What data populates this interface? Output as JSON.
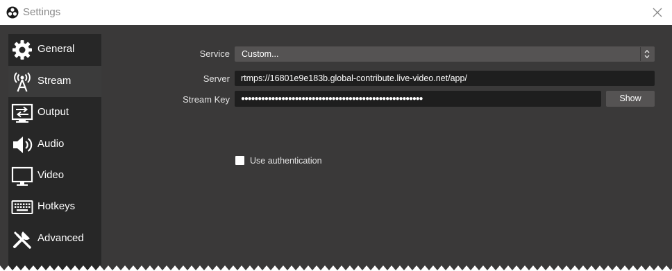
{
  "window": {
    "title": "Settings"
  },
  "sidebar": {
    "items": [
      {
        "label": "General",
        "icon": "gear-icon"
      },
      {
        "label": "Stream",
        "icon": "antenna-icon",
        "active": true
      },
      {
        "label": "Output",
        "icon": "output-icon"
      },
      {
        "label": "Audio",
        "icon": "speaker-icon"
      },
      {
        "label": "Video",
        "icon": "monitor-icon"
      },
      {
        "label": "Hotkeys",
        "icon": "keyboard-icon"
      },
      {
        "label": "Advanced",
        "icon": "tools-icon"
      }
    ]
  },
  "stream": {
    "service_label": "Service",
    "service_value": "Custom...",
    "server_label": "Server",
    "server_value": "rtmps://16801e9e183b.global-contribute.live-video.net/app/",
    "key_label": "Stream Key",
    "key_value": "●●●●●●●●●●●●●●●●●●●●●●●●●●●●●●●●●●●●●●●●●●●●●●●●●●●●●●",
    "show_label": "Show",
    "auth_label": "Use authentication",
    "auth_checked": false
  },
  "colors": {
    "background": "#3a3939",
    "sidebar": "#272727",
    "sidebar_active": "#3b3b3b",
    "input": "#1e1e1e",
    "button": "#555353"
  }
}
